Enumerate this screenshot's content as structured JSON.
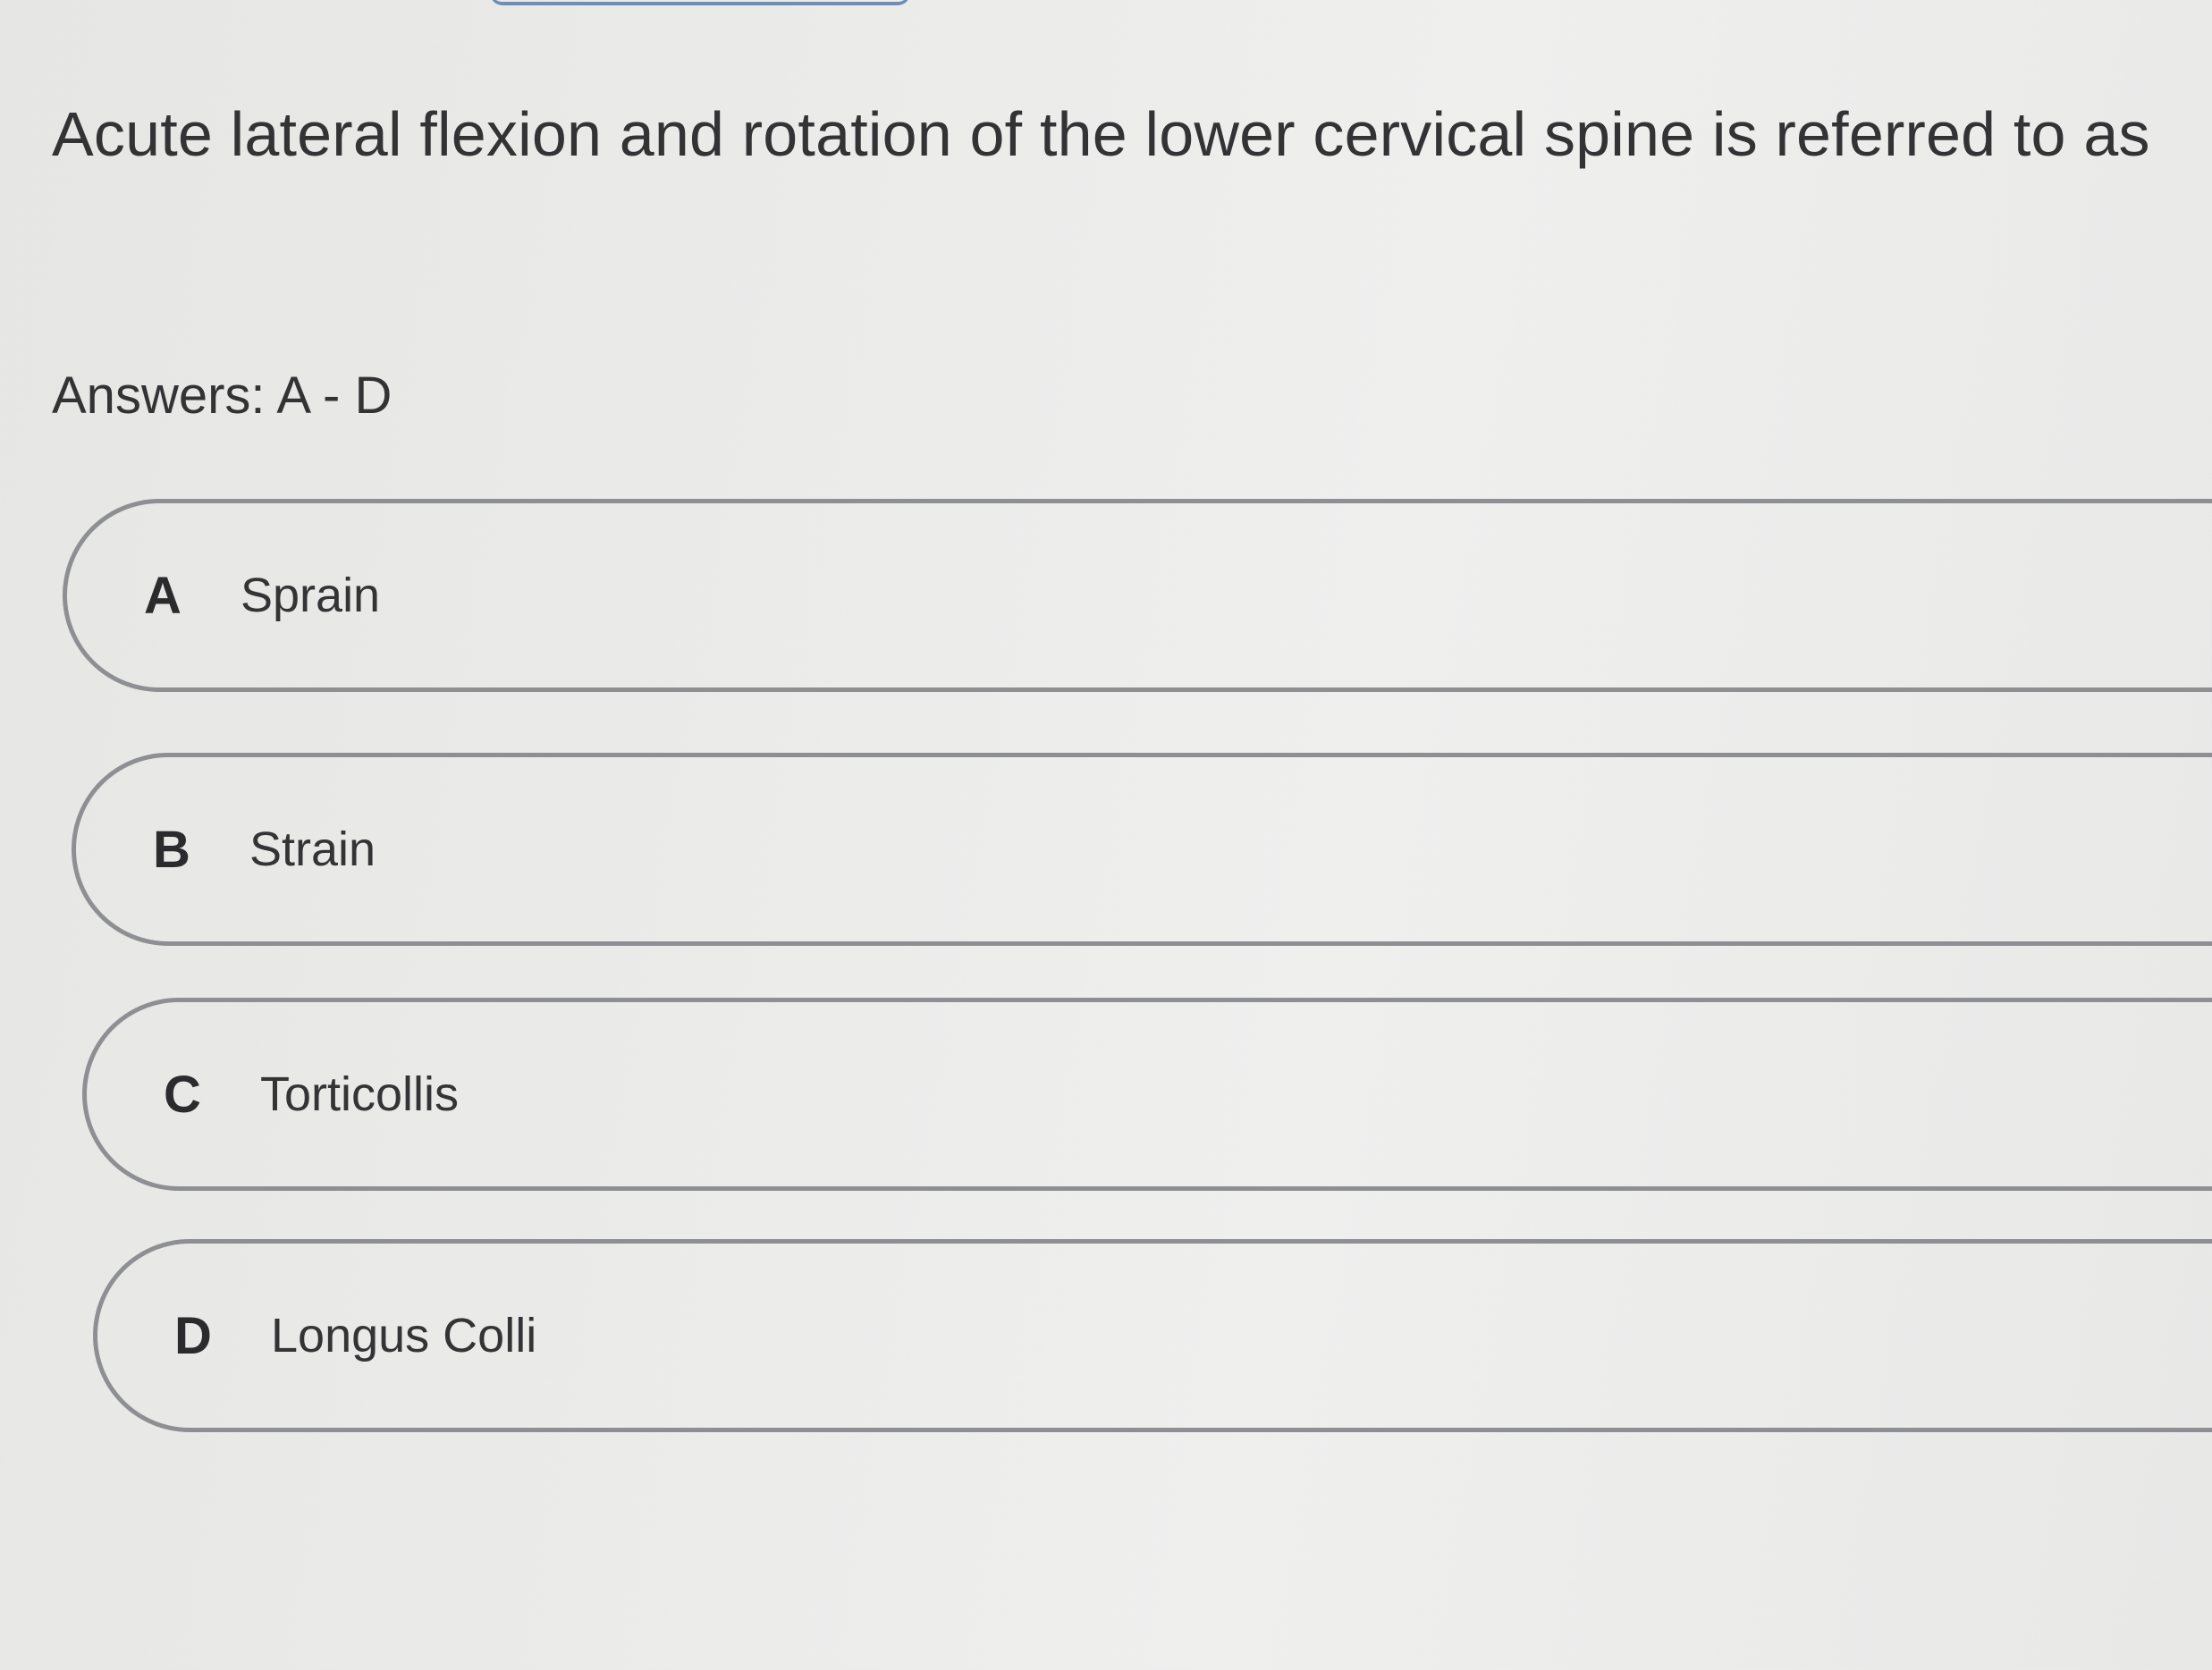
{
  "question": {
    "text": "Acute lateral flexion and rotation of the lower cervical spine is referred to as"
  },
  "answers_hint": "Answers: A - D",
  "options": [
    {
      "letter": "A",
      "text": "Sprain"
    },
    {
      "letter": "B",
      "text": "Strain"
    },
    {
      "letter": "C",
      "text": "Torticollis"
    },
    {
      "letter": "D",
      "text": "Longus Colli"
    }
  ]
}
